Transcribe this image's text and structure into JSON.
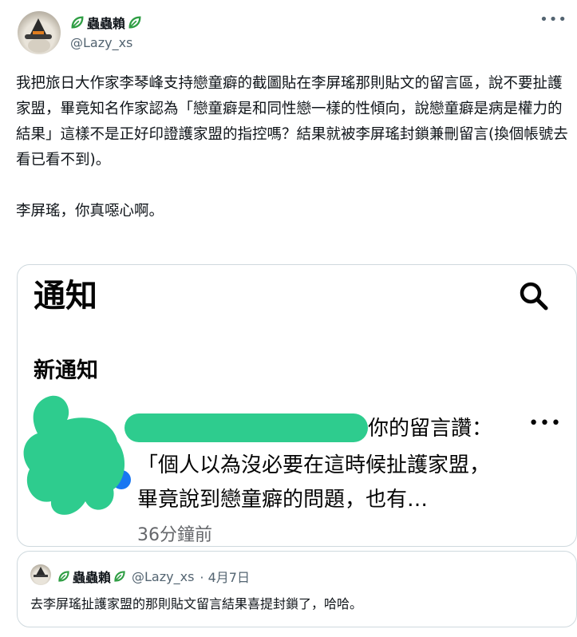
{
  "author": {
    "display_name": "蟲蟲賴",
    "handle": "@Lazy_xs",
    "more_icon": "more-horizontal-icon"
  },
  "tweet_text": "我把旅日大作家李琴峰支持戀童癖的截圖貼在李屏瑤那則貼文的留言區，說不要扯護家盟，畢竟知名作家認為「戀童癖是和同性戀一樣的性傾向，說戀童癖是病是權力的結果」這樣不是正好印證護家盟的指控嗎？結果就被李屏瑤封鎖兼刪留言(換個帳號去看已看不到)。\n\n李屏瑤，你真噁心啊。",
  "screenshot_card": {
    "title": "通知",
    "search_icon": "search-icon",
    "section_label": "新通知",
    "notification_header": "你的留言讚：",
    "notification_quote": "「個人以為沒必要在這時候扯護家盟，畢竟說到戀童癖的問題，也有…",
    "notification_time": "36分鐘前",
    "redaction_color": "#2ecc8e"
  },
  "quoted_tweet": {
    "display_name": "蟲蟲賴",
    "handle": "@Lazy_xs",
    "date": "· 4月7日",
    "text": "去李屏瑤扯護家盟的那則貼文留言結果喜提封鎖了，哈哈。"
  },
  "colors": {
    "leaf_green": "#2f9e44",
    "muted": "#536471",
    "border": "#cfd9de"
  }
}
